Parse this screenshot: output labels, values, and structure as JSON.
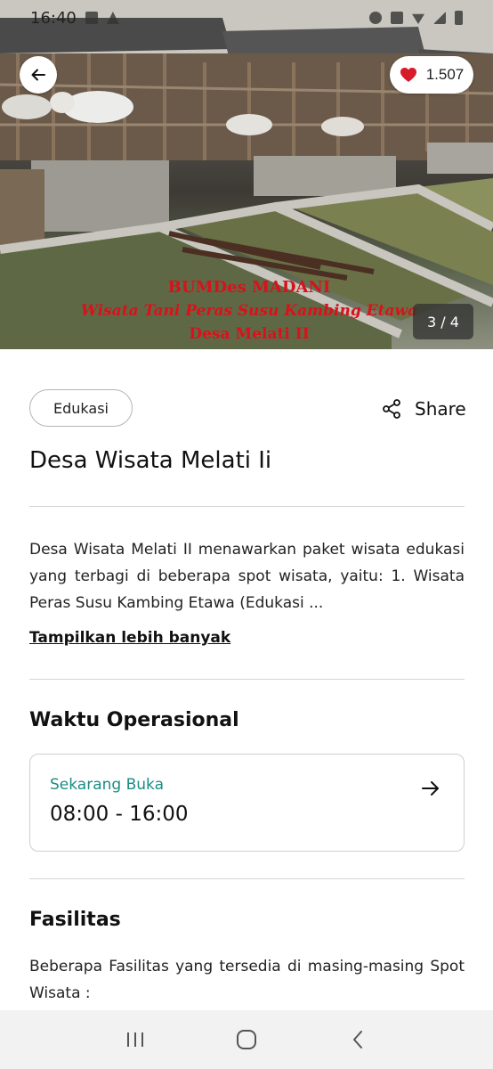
{
  "status_bar": {
    "time": "16:40"
  },
  "hero": {
    "like_count": "1.507",
    "overlay_line1": "BUMDes MADANI",
    "overlay_line2": "Wisata Tani Peras Susu Kambing Etawa",
    "overlay_line3": "Desa Melati II",
    "image_counter": "3 / 4"
  },
  "place": {
    "category": "Edukasi",
    "share_label": "Share",
    "title": "Desa Wisata Melati Ii",
    "description": "Desa Wisata Melati II menawarkan paket wisata edukasi yang terbagi di beberapa spot wisata, yaitu: 1. Wisata Peras Susu Kambing Etawa (Edukasi ...",
    "more_label": "Tampilkan lebih banyak"
  },
  "hours": {
    "section_title": "Waktu Operasional",
    "status": "Sekarang Buka",
    "time": "08:00 - 16:00"
  },
  "facilities": {
    "section_title": "Fasilitas",
    "description": "Beberapa Fasilitas yang tersedia di masing-masing Spot Wisata :"
  },
  "colors": {
    "accent_open": "#1a8c84",
    "heart": "#d81b2a",
    "overlay_text": "#d8121a"
  },
  "icons": {
    "back": "arrow-left-icon",
    "like": "heart-icon",
    "share": "share-icon",
    "hours_arrow": "arrow-right-icon",
    "nav_recents": "recents-icon",
    "nav_home": "home-icon",
    "nav_back": "chevron-left-icon"
  }
}
